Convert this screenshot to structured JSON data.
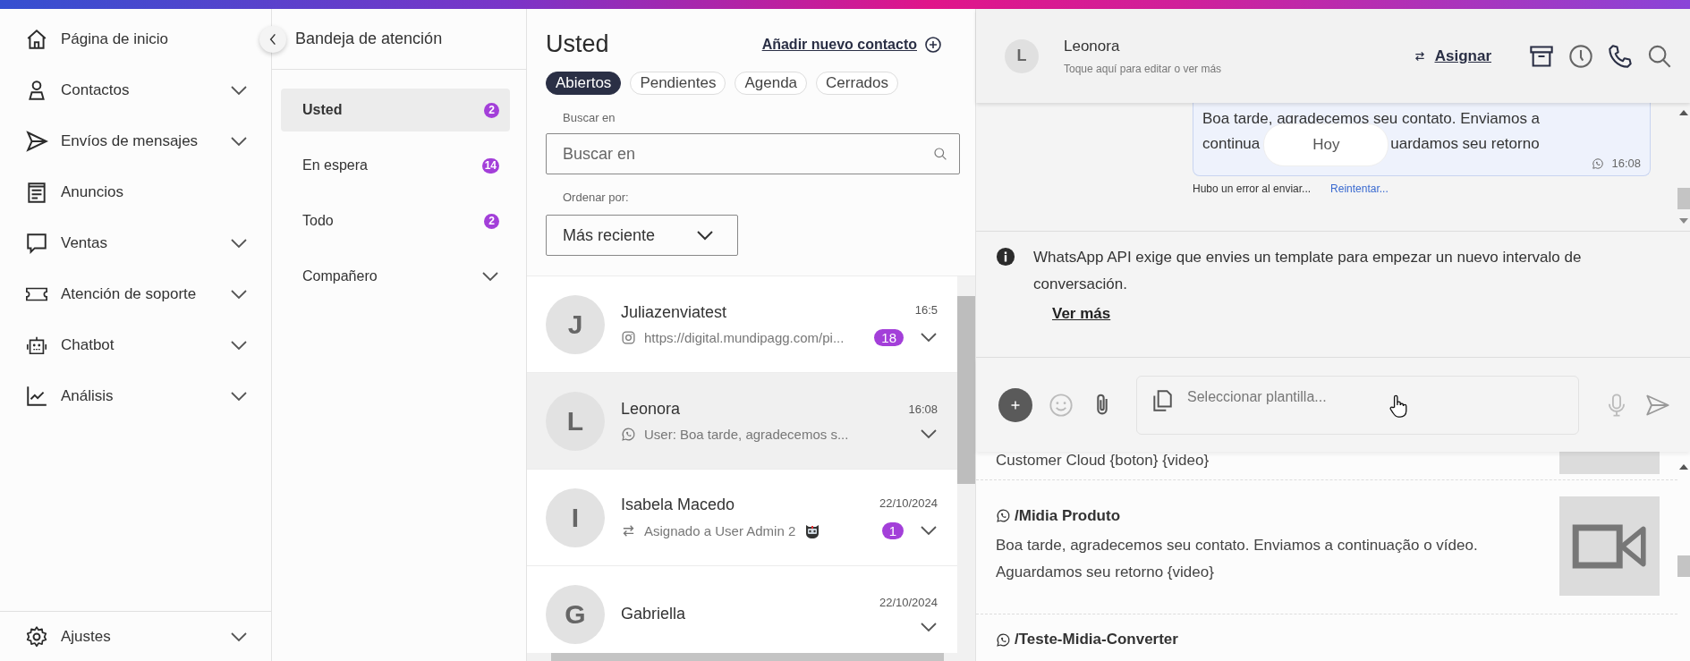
{
  "nav": {
    "items": [
      {
        "label": "Página de inicio",
        "expandable": false
      },
      {
        "label": "Contactos",
        "expandable": true
      },
      {
        "label": "Envíos de mensajes",
        "expandable": true
      },
      {
        "label": "Anuncios",
        "expandable": false
      },
      {
        "label": "Ventas",
        "expandable": true
      },
      {
        "label": "Atención de soporte",
        "expandable": true
      },
      {
        "label": "Chatbot",
        "expandable": true
      },
      {
        "label": "Análisis",
        "expandable": true
      }
    ],
    "settings": {
      "label": "Ajustes",
      "expandable": true
    }
  },
  "inbox": {
    "title": "Bandeja de atención",
    "items": [
      {
        "label": "Usted",
        "count": "2",
        "selected": true,
        "expandable": false
      },
      {
        "label": "En espera",
        "count": "14",
        "selected": false,
        "expandable": false
      },
      {
        "label": "Todo",
        "count": "2",
        "selected": false,
        "expandable": false
      },
      {
        "label": "Compañero",
        "selected": false,
        "expandable": true
      }
    ]
  },
  "conversations": {
    "title": "Usted",
    "add_link": "Añadir nuevo contacto",
    "filters": [
      {
        "label": "Abiertos",
        "selected": true
      },
      {
        "label": "Pendientes",
        "selected": false
      },
      {
        "label": "Agenda",
        "selected": false
      },
      {
        "label": "Cerrados",
        "selected": false
      }
    ],
    "search": {
      "label": "Buscar en",
      "placeholder": "Buscar en"
    },
    "sort": {
      "label": "Ordenar por:",
      "value": "Más reciente"
    },
    "rows": [
      {
        "initial": "J",
        "name": "Juliazenviatest",
        "time": "16:5",
        "kind": "instagram",
        "preview": "https://digital.mundipagg.com/pi...",
        "unread": "18",
        "selected": false
      },
      {
        "initial": "L",
        "name": "Leonora",
        "time": "16:08",
        "kind": "whatsapp",
        "preview": "User: Boa tarde, agradecemos s...",
        "selected": true
      },
      {
        "initial": "I",
        "name": "Isabela Macedo",
        "time": "22/10/2024",
        "kind": "assigned",
        "preview": "Asignado a User Admin 2",
        "unread": "1",
        "selected": false
      },
      {
        "initial": "G",
        "name": "Gabriella",
        "time": "22/10/2024",
        "selected": false
      }
    ]
  },
  "chat": {
    "contact": {
      "initial": "L",
      "name": "Leonora",
      "hint": "Toque aquí para editar o ver más"
    },
    "assign": "Asignar",
    "message": {
      "first_line": "Boa tarde, agradecemos seu contato. Enviamos a",
      "covered_line": [
        "continua",
        "uardamos seu retorno"
      ],
      "time": "16:08",
      "error": "Hubo un error al enviar...",
      "retry": "Reintentar..."
    },
    "date_pill": "Hoy",
    "notice": {
      "text": "WhatsApp API exige que envies un template para empezar un nuevo intervalo de conversación.",
      "link": "Ver más"
    },
    "composer": {
      "placeholder": "Seleccionar plantilla..."
    },
    "templates": [
      {
        "text": "Customer Cloud {boton} {video}",
        "video": true
      },
      {
        "title": "/Midia Produto",
        "text": "Boa tarde, agradecemos seu contato. Enviamos a continuação o vídeo. Aguardamos seu retorno {video}",
        "video": true
      },
      {
        "title": "/Teste-Midia-Converter"
      }
    ]
  }
}
